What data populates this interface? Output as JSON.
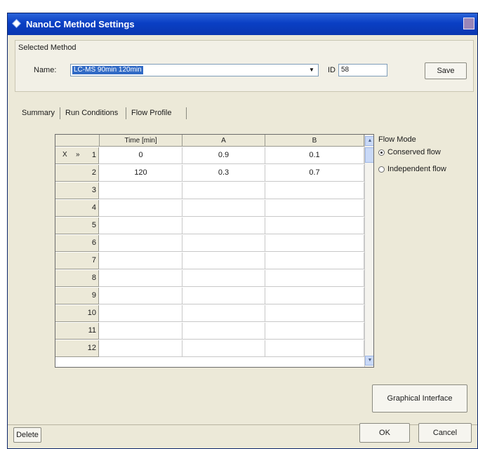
{
  "window": {
    "title": "NanoLC Method Settings"
  },
  "selected_method": {
    "legend": "Selected Method",
    "name_label": "Name:",
    "name_value": "LC-MS 90min 120min",
    "id_label": "ID",
    "id_value": "58",
    "save_label": "Save"
  },
  "tabs": [
    {
      "label": "Summary"
    },
    {
      "label": "Run Conditions"
    },
    {
      "label": "Flow Profile"
    }
  ],
  "grid": {
    "columns": [
      "Time [min]",
      "A",
      "B"
    ],
    "rows": [
      {
        "num": "1",
        "indicator": "X",
        "indicator2": "»",
        "time": "0",
        "a": "0.9",
        "b": "0.1"
      },
      {
        "num": "2",
        "indicator": "",
        "indicator2": "",
        "time": "120",
        "a": "0.3",
        "b": "0.7"
      },
      {
        "num": "3",
        "indicator": "",
        "indicator2": "",
        "time": "",
        "a": "",
        "b": ""
      },
      {
        "num": "4",
        "indicator": "",
        "indicator2": "",
        "time": "",
        "a": "",
        "b": ""
      },
      {
        "num": "5",
        "indicator": "",
        "indicator2": "",
        "time": "",
        "a": "",
        "b": ""
      },
      {
        "num": "6",
        "indicator": "",
        "indicator2": "",
        "time": "",
        "a": "",
        "b": ""
      },
      {
        "num": "7",
        "indicator": "",
        "indicator2": "",
        "time": "",
        "a": "",
        "b": ""
      },
      {
        "num": "8",
        "indicator": "",
        "indicator2": "",
        "time": "",
        "a": "",
        "b": ""
      },
      {
        "num": "9",
        "indicator": "",
        "indicator2": "",
        "time": "",
        "a": "",
        "b": ""
      },
      {
        "num": "10",
        "indicator": "",
        "indicator2": "",
        "time": "",
        "a": "",
        "b": ""
      },
      {
        "num": "11",
        "indicator": "",
        "indicator2": "",
        "time": "",
        "a": "",
        "b": ""
      },
      {
        "num": "12",
        "indicator": "",
        "indicator2": "",
        "time": "",
        "a": "",
        "b": ""
      }
    ]
  },
  "flow_mode": {
    "legend": "Flow Mode",
    "options": [
      "Conserved flow",
      "Independent flow"
    ],
    "selected": "Conserved flow"
  },
  "buttons": {
    "graphical": "Graphical Interface",
    "delete": "Delete",
    "ok": "OK",
    "cancel": "Cancel"
  }
}
